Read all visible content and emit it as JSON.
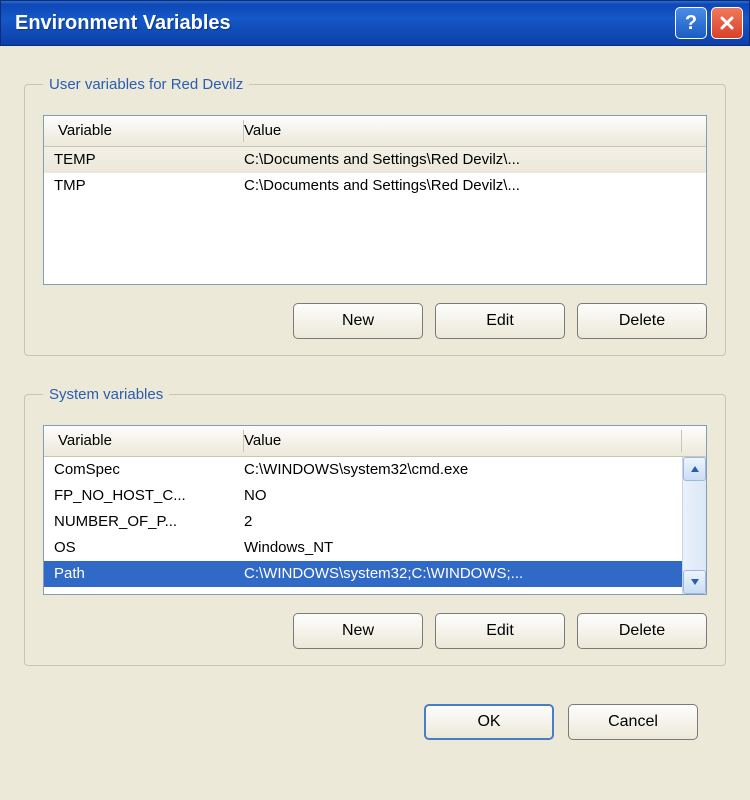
{
  "window": {
    "title": "Environment Variables"
  },
  "userSection": {
    "legend": "User variables for Red Devilz",
    "colVariable": "Variable",
    "colValue": "Value",
    "rows": [
      {
        "variable": "TEMP",
        "value": "C:\\Documents and Settings\\Red Devilz\\..."
      },
      {
        "variable": "TMP",
        "value": "C:\\Documents and Settings\\Red Devilz\\..."
      }
    ],
    "buttons": {
      "new": "New",
      "edit": "Edit",
      "delete": "Delete"
    }
  },
  "systemSection": {
    "legend": "System variables",
    "colVariable": "Variable",
    "colValue": "Value",
    "rows": [
      {
        "variable": "ComSpec",
        "value": "C:\\WINDOWS\\system32\\cmd.exe"
      },
      {
        "variable": "FP_NO_HOST_C...",
        "value": "NO"
      },
      {
        "variable": "NUMBER_OF_P...",
        "value": "2"
      },
      {
        "variable": "OS",
        "value": "Windows_NT"
      },
      {
        "variable": "Path",
        "value": "C:\\WINDOWS\\system32;C:\\WINDOWS;...",
        "selected": true
      }
    ],
    "buttons": {
      "new": "New",
      "edit": "Edit",
      "delete": "Delete"
    }
  },
  "dialog": {
    "ok": "OK",
    "cancel": "Cancel"
  }
}
